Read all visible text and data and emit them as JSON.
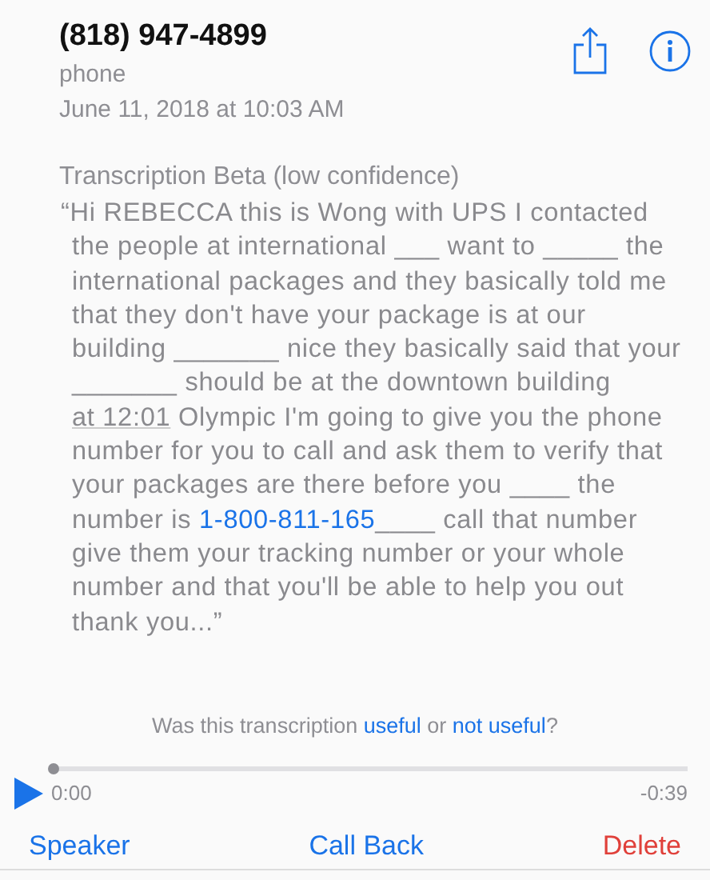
{
  "header": {
    "number": "(818) 947-4899",
    "label": "phone",
    "date": "June 11, 2018 at 10:03 AM"
  },
  "transcription": {
    "title": "Transcription Beta (low confidence)",
    "segments": [
      {
        "kind": "text",
        "text": "“Hi REBECCA this is Wong with UPS I contacted the people at international ___ want to _____ the international packages and they basically told me that they don't have your package is at our building _______ nice they basically said that your _______ should be at the downtown building "
      },
      {
        "kind": "detected",
        "text": "at 12:01"
      },
      {
        "kind": "text",
        "text": " Olympic I'm going to give you the phone number for you to call and ask them to verify that your packages are there before you ____ the number is "
      },
      {
        "kind": "link",
        "text": "1-800-811-165"
      },
      {
        "kind": "text",
        "text": "____ call that number give them your tracking number or your whole number and that you'll be able to help you out thank you...”"
      }
    ]
  },
  "feedback": [
    {
      "kind": "text",
      "text": "Was this transcription "
    },
    {
      "kind": "link",
      "text": "useful"
    },
    {
      "kind": "text",
      "text": " or "
    },
    {
      "kind": "link",
      "text": "not useful"
    },
    {
      "kind": "text",
      "text": "?"
    }
  ],
  "player": {
    "level": 0,
    "elapsed": "0:00",
    "remaining": "-0:39"
  },
  "buttons": [
    {
      "label": "Speaker",
      "kind": "normal"
    },
    {
      "label": "Call Back",
      "kind": "normal"
    },
    {
      "label": "Delete",
      "kind": "destructive"
    }
  ]
}
